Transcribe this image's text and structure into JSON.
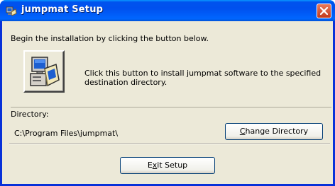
{
  "window": {
    "title": "jumpmat Setup",
    "accent_color": "#0831d9",
    "close_icon": "close-icon"
  },
  "main": {
    "intro_text": "Begin the installation by clicking the button below.",
    "install_description": "Click this button to install jumpmat software to the specified destination directory.",
    "install_icon": "computer-install-icon"
  },
  "directory": {
    "label": "Directory:",
    "value": "C:\\Program Files\\jumpmat\\",
    "change_button": {
      "mnemonic": "C",
      "rest": "hange Directory"
    }
  },
  "footer": {
    "exit_button": {
      "before": "E",
      "mnemonic": "x",
      "after": "it Setup"
    }
  }
}
